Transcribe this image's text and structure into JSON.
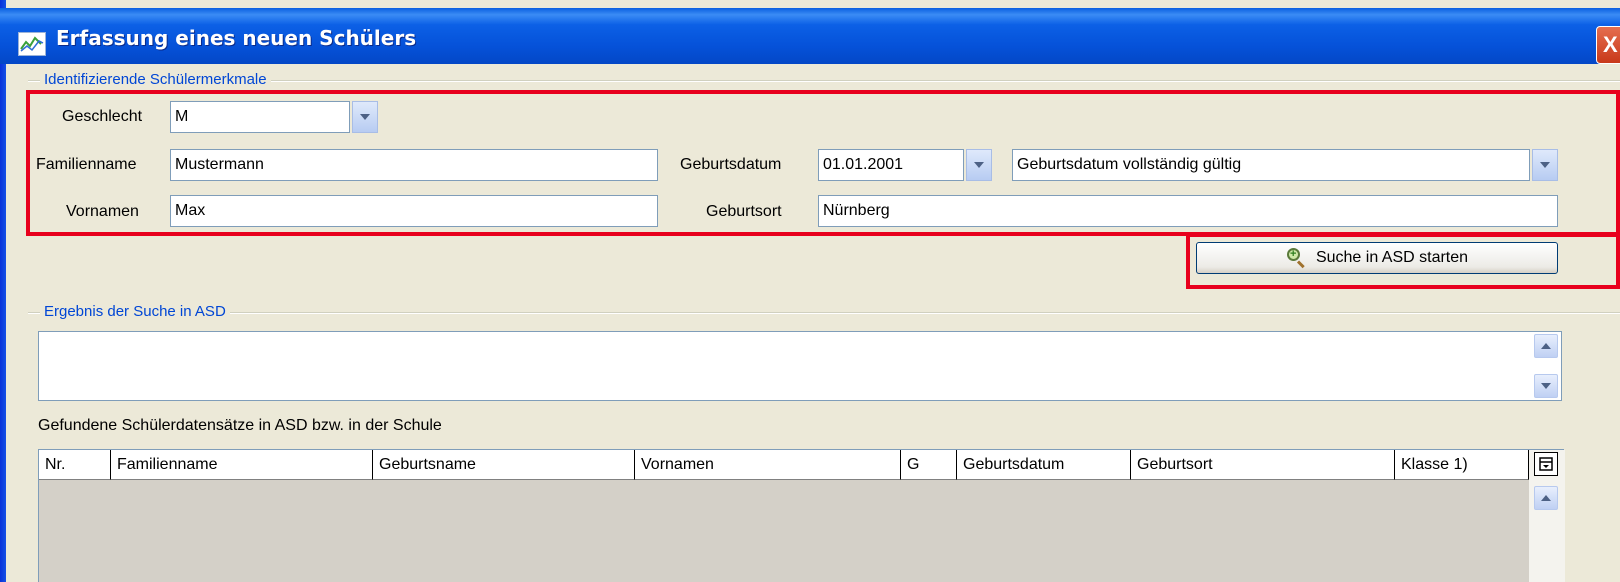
{
  "window": {
    "title": "Erfassung eines neuen Schülers",
    "close_label": "X"
  },
  "ident_group": {
    "title": "Identifizierende Schülermerkmale",
    "geschlecht_label": "Geschlecht",
    "geschlecht_value": "M",
    "familienname_label": "Familienname",
    "familienname_value": "Mustermann",
    "vornamen_label": "Vornamen",
    "vornamen_value": "Max",
    "geburtsdatum_label": "Geburtsdatum",
    "geburtsdatum_value": "01.01.2001",
    "geburtsdatum_status_value": "Geburtsdatum vollständig gültig",
    "geburtsort_label": "Geburtsort",
    "geburtsort_value": "Nürnberg"
  },
  "search_button": {
    "label": "Suche in ASD starten",
    "icon": "magnifier-add-icon"
  },
  "result_group": {
    "title": "Ergebnis der Suche in ASD",
    "text": ""
  },
  "found_records": {
    "label": "Gefundene Schülerdatensätze in ASD bzw. in der Schule",
    "columns": [
      "Nr.",
      "Familienname",
      "Geburtsname",
      "Vornamen",
      "G",
      "Geburtsdatum",
      "Geburtsort",
      "Klasse 1)"
    ],
    "rows": []
  },
  "colors": {
    "highlight": "#e8001d",
    "group_title": "#0046d5",
    "window_bg": "#ece9d8"
  }
}
